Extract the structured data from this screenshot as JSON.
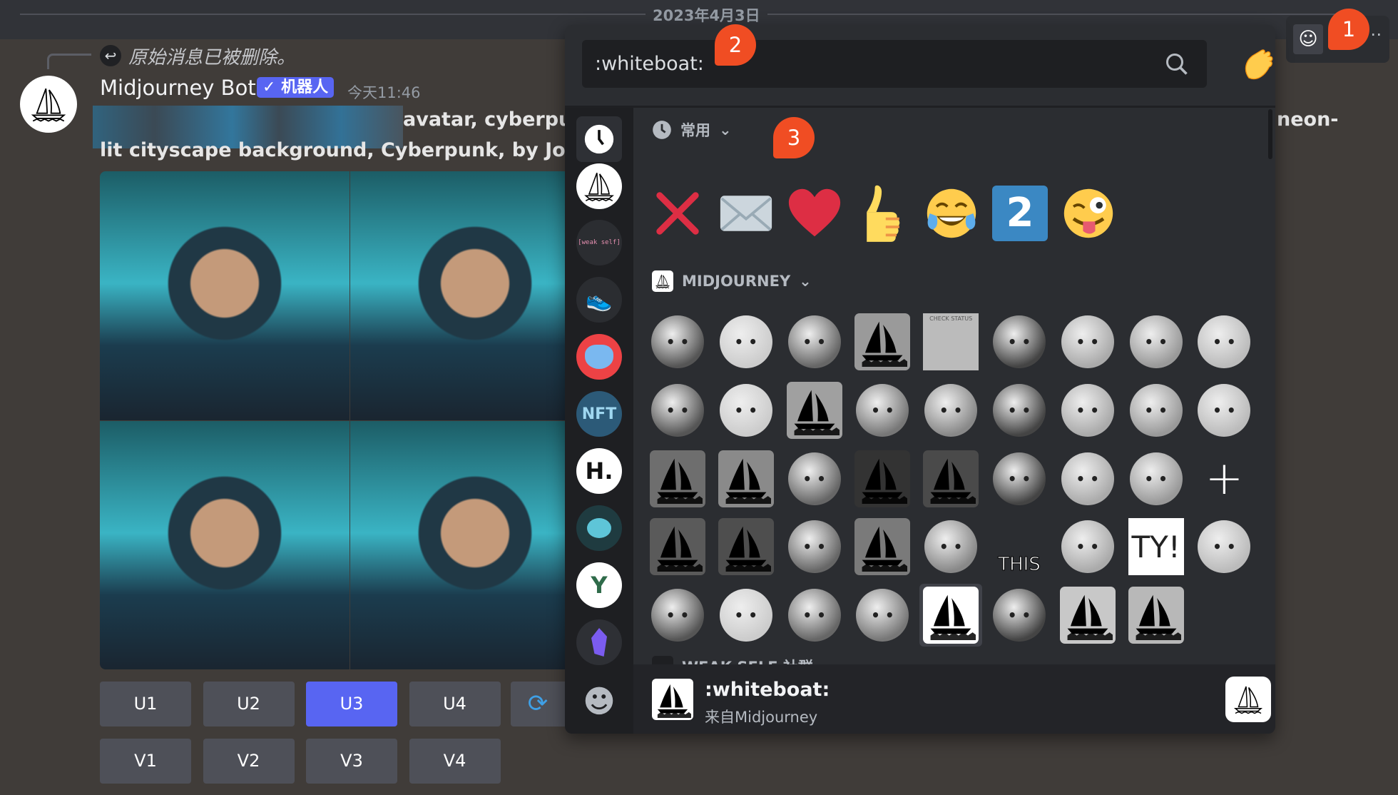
{
  "date_divider": "2023年4月3日",
  "reply": {
    "text": "原始消息已被删除。"
  },
  "message": {
    "author": "Midjourney Bot",
    "bot_tag": "✓ 机器人",
    "timestamp": "今天11:46",
    "line1": "avatar, cyberpun",
    "line1_tail": "neon-",
    "line2": "lit cityscape background, Cyberpunk, by Josan",
    "buttons_row1": [
      "U1",
      "U2",
      "U3",
      "U4"
    ],
    "buttons_row2": [
      "V1",
      "V2",
      "V3",
      "V4"
    ],
    "active_button": "U3",
    "accent": "#5865f2"
  },
  "picker": {
    "search_value": ":whiteboat:",
    "frequent_label": "常用",
    "midjourney_label": "MIDJOURNEY",
    "weak_self_label": "WEAK SELF 社群",
    "frequent": [
      "cross-mark",
      "envelope",
      "red-heart",
      "thumbs-up",
      "joy",
      "keycap-2",
      "winking-tongue"
    ],
    "keycap_text": "2",
    "sidebar": [
      "recent-clock",
      "midjourney-server",
      "weak-self-server",
      "sneaker-server",
      "cat-server",
      "nft-server",
      "h-server",
      "paw-server",
      "y-server",
      "crystal-server",
      "default-emoji-smiley"
    ],
    "weak_self_text": "[weak self]",
    "h_text": "H.",
    "nft_text": "NFT",
    "grid": [
      {
        "n": "cloud-face"
      },
      {
        "n": "sword"
      },
      {
        "n": "dog"
      },
      {
        "n": "boat",
        "bg": "#9a9a9a"
      },
      {
        "n": "check-status-robot",
        "label": "CHECK STATUS"
      },
      {
        "n": "blurry-animal"
      },
      {
        "n": "octopus-facepalm"
      },
      {
        "n": "big-eyes-blob"
      },
      {
        "n": "sad-ghost"
      },
      {
        "n": "grin-face"
      },
      {
        "n": "portrait"
      },
      {
        "n": "boat",
        "bg": "#a0a0a0"
      },
      {
        "n": "dragon"
      },
      {
        "n": "smile-blob"
      },
      {
        "n": "mask-face"
      },
      {
        "n": "blush-cat"
      },
      {
        "n": "muscle-man"
      },
      {
        "n": "cookie-face"
      },
      {
        "n": "boat",
        "bg": "#6e6e6e"
      },
      {
        "n": "boat",
        "bg": "#8a8a8a"
      },
      {
        "n": "smile-ghost"
      },
      {
        "n": "boat",
        "bg": "#333333"
      },
      {
        "n": "boat",
        "bg": "#4a4a4a"
      },
      {
        "n": "plague-doctor"
      },
      {
        "n": "bird-mask-heart"
      },
      {
        "n": "hooded-figure"
      },
      {
        "n": "add-emoji"
      },
      {
        "n": "boat",
        "bg": "#5a5a5a"
      },
      {
        "n": "boat",
        "bg": "#4e4e4e"
      },
      {
        "n": "skull-eyes"
      },
      {
        "n": "boat",
        "bg": "#7a7a7a"
      },
      {
        "n": "thinking-blob"
      },
      {
        "n": "this-arrow",
        "label": "THIS"
      },
      {
        "n": "angry-blob"
      },
      {
        "n": "ty-sign",
        "label": "TY!"
      },
      {
        "n": "blurry-creature"
      },
      {
        "n": "blurry-cloud"
      },
      {
        "n": "sad-face"
      },
      {
        "n": "expand-arrows"
      },
      {
        "n": "egg-face"
      },
      {
        "n": "whiteboat",
        "bg": "#ffffff",
        "selected": true
      },
      {
        "n": "robot-head"
      },
      {
        "n": "boat",
        "bg": "#c8c8c8"
      },
      {
        "n": "boat",
        "bg": "#b8b8b8"
      }
    ],
    "preview": {
      "name": ":whiteboat:",
      "source": "来自Midjourney"
    }
  },
  "annotations": [
    "1",
    "2",
    "3"
  ],
  "annotation_color": "#f04d23"
}
